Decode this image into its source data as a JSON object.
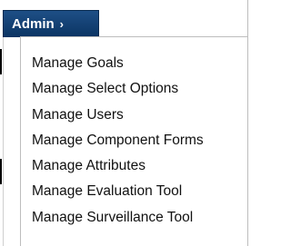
{
  "menu": {
    "title": "Admin",
    "chevron": "›",
    "items": [
      {
        "label": "Manage Goals"
      },
      {
        "label": "Manage Select Options"
      },
      {
        "label": "Manage Users"
      },
      {
        "label": "Manage Component Forms"
      },
      {
        "label": "Manage Attributes"
      },
      {
        "label": "Manage Evaluation Tool"
      },
      {
        "label": "Manage Surveillance Tool"
      }
    ]
  },
  "colors": {
    "header_bg": "#0f3b6b",
    "header_text": "#ffffff",
    "item_text": "#111111",
    "border": "#bdbdbd"
  }
}
